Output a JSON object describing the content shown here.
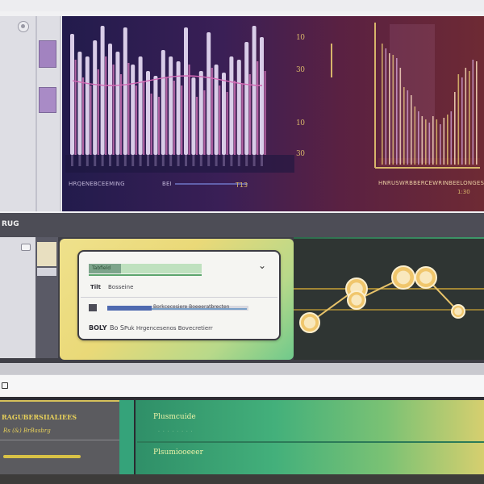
{
  "section_bar": {
    "label": "RUG"
  },
  "chart": {
    "axis_top": "10",
    "axis_mid": "30",
    "axis_low": "10",
    "axis_bottom": "30",
    "left_caption": "HRQENEBCEEMING",
    "center_label": "BEI",
    "center_value": "T13",
    "right_caption": "HNRUSWRBBERCEWRINBEELONGES",
    "right_corner": "1:30",
    "heights_primary": [
      150,
      128,
      122,
      142,
      160,
      138,
      128,
      158,
      112,
      122,
      104,
      98,
      130,
      122,
      116,
      158,
      96,
      104,
      152,
      112,
      102,
      122,
      118,
      140,
      160,
      146
    ],
    "heights_secondary": [
      118,
      96,
      86,
      106,
      122,
      112,
      100,
      114,
      86,
      92,
      76,
      72,
      96,
      92,
      86,
      112,
      72,
      80,
      108,
      86,
      78,
      92,
      88,
      100,
      116,
      104
    ],
    "right_heights": [
      150,
      144,
      138,
      136,
      132,
      120,
      96,
      92,
      86,
      72,
      66,
      60,
      56,
      52,
      60,
      56,
      50,
      58,
      62,
      66,
      90,
      112,
      108,
      120,
      116,
      130,
      128
    ]
  },
  "form": {
    "header_tag": "Tabfield",
    "row1_key": "Tilt",
    "row1_val": "Bosseine",
    "row2_val": "Borkcecesiere Boeeeratbrecten",
    "row3_key": "BOLY",
    "row3_val": "Bo S",
    "row3_tail": "Puk Hrgencesenos Bovecretierr",
    "chevron": "⌄"
  },
  "line_chart": {
    "points": [
      6,
      3,
      4,
      2,
      2,
      5
    ]
  },
  "bottom": {
    "left_title": "RAGUBERSIIALIEES",
    "left_sub": "Rs (&) BrBasbrg",
    "right_title": "Plusmcuide",
    "right_sub": "Plsumiooeeer",
    "right_dots": "· · · · · · · ·"
  },
  "colors": {
    "gold": "#d8b56a",
    "lavender": "#b9a7d6",
    "magenta": "#c86fb1",
    "green_accent": "#43b07b"
  }
}
